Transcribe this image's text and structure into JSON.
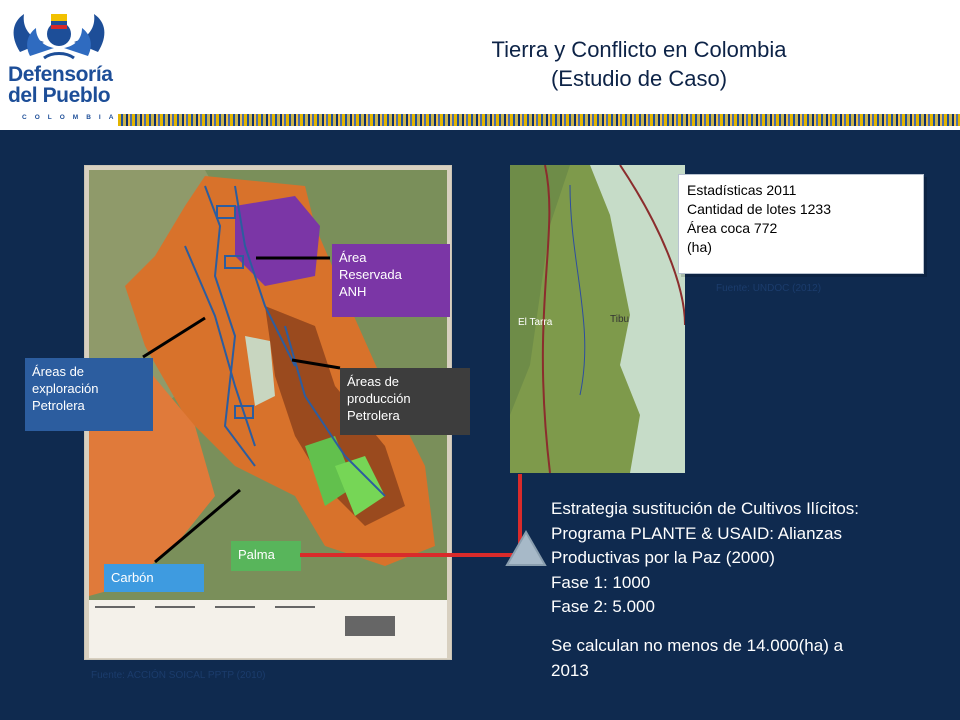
{
  "header": {
    "logo_line1": "Defensoría",
    "logo_line2": "del Pueblo",
    "logo_country": "COLOMBIA",
    "title_line1": "Tierra y Conflicto en Colombia",
    "title_line2": "(Estudio de Caso)"
  },
  "left_map": {
    "label_reserve": [
      "Área",
      "Reservada",
      "ANH"
    ],
    "label_exploration": [
      "Áreas de",
      "exploración",
      "Petrolera"
    ],
    "label_production": [
      "Áreas de",
      "producción",
      "Petrolera"
    ],
    "label_palm": "Palma",
    "label_coal": "Carbón",
    "source": "Fuente:  ACCIÓN  SOICAL  PPTP (2010)",
    "place_tibu": "Tibu",
    "place_el_tarra": "El Tarra"
  },
  "stats": {
    "line1": "Estadísticas  2011",
    "line2": "Cantidad de lotes   1233",
    "line3": "Área coca              772",
    "line4": "(ha)",
    "source": "Fuente: UNDOC (2012)"
  },
  "strategy": {
    "line1": "Estrategia sustitución de Cultivos Ilícitos:",
    "line2": "Programa PLANTE & USAID: Alianzas",
    "line3": "Productivas por la Paz (2000)",
    "line4": "Fase 1: 1000",
    "line5": "Fase 2: 5.000",
    "line6": "Se calculan no menos de 14.000(ha) a",
    "line7": "2013"
  },
  "colors": {
    "background": "#0f2a4f",
    "reserve": "#7b36a6",
    "exploration": "#2c5d9f",
    "production": "#3d3d3d",
    "palm": "#58b55b",
    "coal": "#3e9be0",
    "connector": "#d92b2b"
  }
}
